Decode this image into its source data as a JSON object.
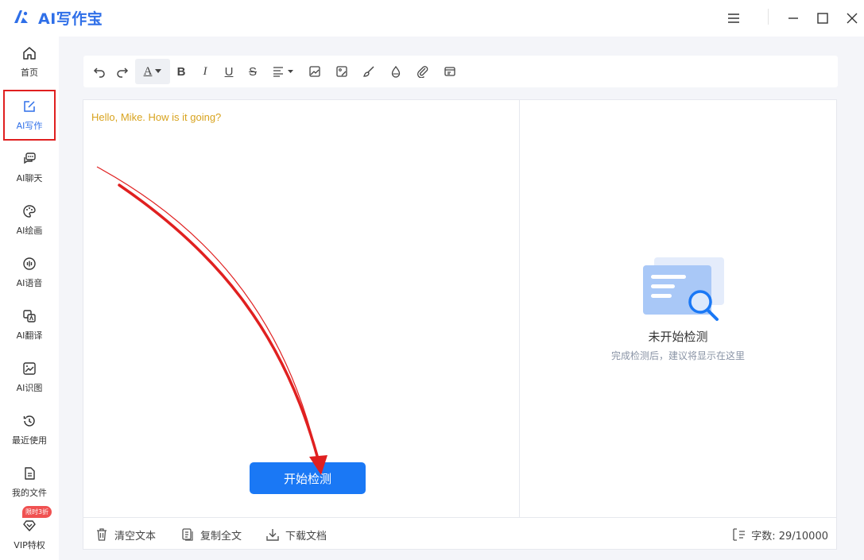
{
  "app": {
    "title": "AI写作宝",
    "brand_color": "#2f6fe8",
    "icon": "logo-icon"
  },
  "window_controls": {
    "menu_icon": "menu-icon",
    "minimize_icon": "minimize-icon",
    "maximize_icon": "maximize-icon",
    "close_icon": "close-icon"
  },
  "sidebar": {
    "items": [
      {
        "label": "首页",
        "icon": "home-icon"
      },
      {
        "label": "AI写作",
        "icon": "edit-icon",
        "active": true
      },
      {
        "label": "AI聊天",
        "icon": "chat-icon"
      },
      {
        "label": "AI绘画",
        "icon": "palette-icon"
      },
      {
        "label": "AI语音",
        "icon": "audio-icon"
      },
      {
        "label": "AI翻译",
        "icon": "translate-icon"
      },
      {
        "label": "AI识图",
        "icon": "image-recognize-icon"
      },
      {
        "label": "最近使用",
        "icon": "history-icon"
      },
      {
        "label": "我的文件",
        "icon": "file-icon"
      },
      {
        "label": "VIP特权",
        "icon": "diamond-icon"
      }
    ],
    "promo_badge": "限时3折"
  },
  "toolbar": {
    "items": [
      "undo-icon",
      "redo-icon",
      "font-color-icon",
      "bold-icon",
      "italic-icon",
      "underline-icon",
      "strikethrough-icon",
      "align-icon",
      "image-icon",
      "image-edit-icon",
      "brush-icon",
      "water-drop-icon",
      "attachment-icon",
      "template-icon"
    ],
    "font_color_label": "A",
    "bold_label": "B",
    "italic_label": "I",
    "underline_label": "U",
    "strike_label": "S"
  },
  "editor": {
    "content": "Hello, Mike. How is it going?",
    "content_color": "#d8a31e",
    "start_button": "开始检测"
  },
  "result_panel": {
    "empty_title": "未开始检测",
    "empty_subtitle": "完成检测后，建议将显示在这里",
    "illustration": "document-search-icon"
  },
  "footer": {
    "clear_label": "清空文本",
    "copy_label": "复制全文",
    "download_label": "下载文档",
    "word_count_label": "字数: 29/10000"
  },
  "colors": {
    "accent": "#1a78f5",
    "annotation_red": "#e02020"
  }
}
